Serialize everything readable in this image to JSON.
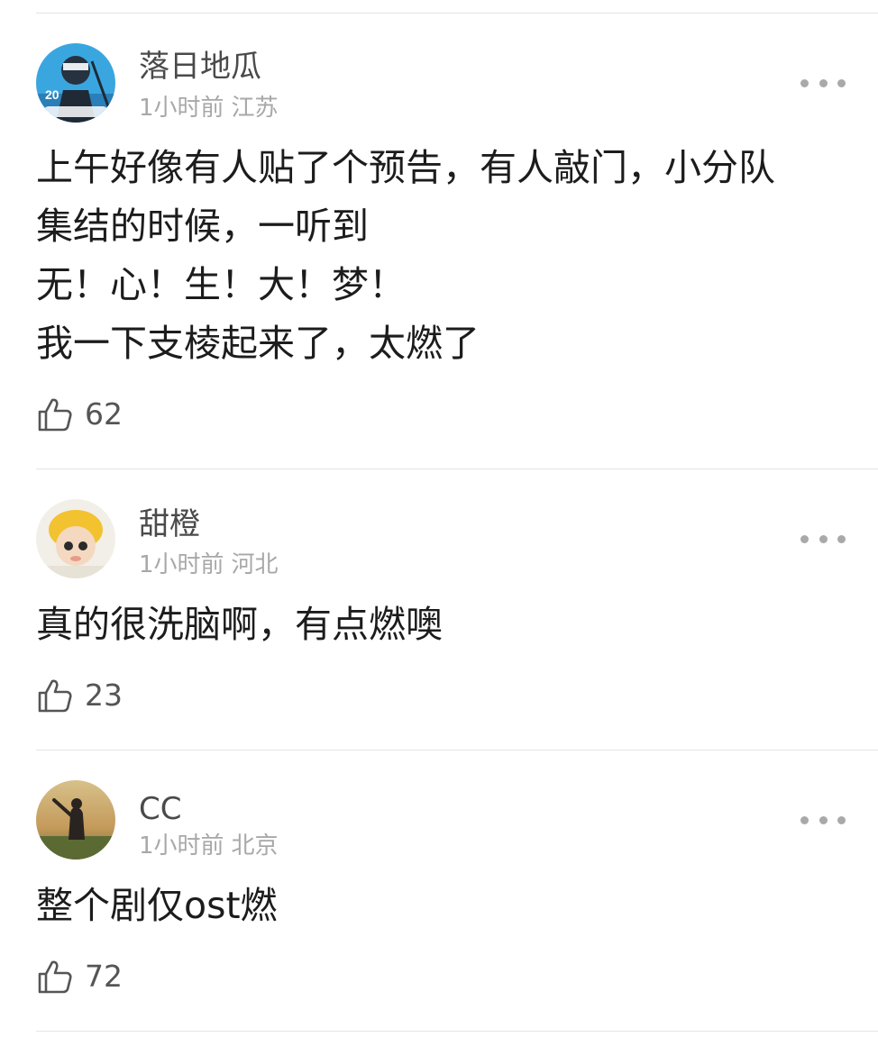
{
  "comments": [
    {
      "username": "落日地瓜",
      "time": "1小时前",
      "location": "江苏",
      "lines": [
        "上午好像有人贴了个预告，有人敲门，小分队",
        "集结的时候，一听到",
        "无！心！生！大！梦！",
        "我一下支棱起来了，太燃了"
      ],
      "likes": "62"
    },
    {
      "username": "甜橙",
      "time": "1小时前",
      "location": "河北",
      "lines": [
        "真的很洗脑啊，有点燃噢"
      ],
      "likes": "23"
    },
    {
      "username": "CC",
      "time": "1小时前",
      "location": "北京",
      "lines": [
        "整个剧仅ost燃"
      ],
      "likes": "72"
    }
  ],
  "icons": {
    "like": "thumbs-up-icon",
    "more": "more-dots-icon"
  },
  "colors": {
    "username": "#4a4a4a",
    "meta": "#a8a8a8",
    "text": "#1c1c1c",
    "divider": "#e4e4e4"
  }
}
